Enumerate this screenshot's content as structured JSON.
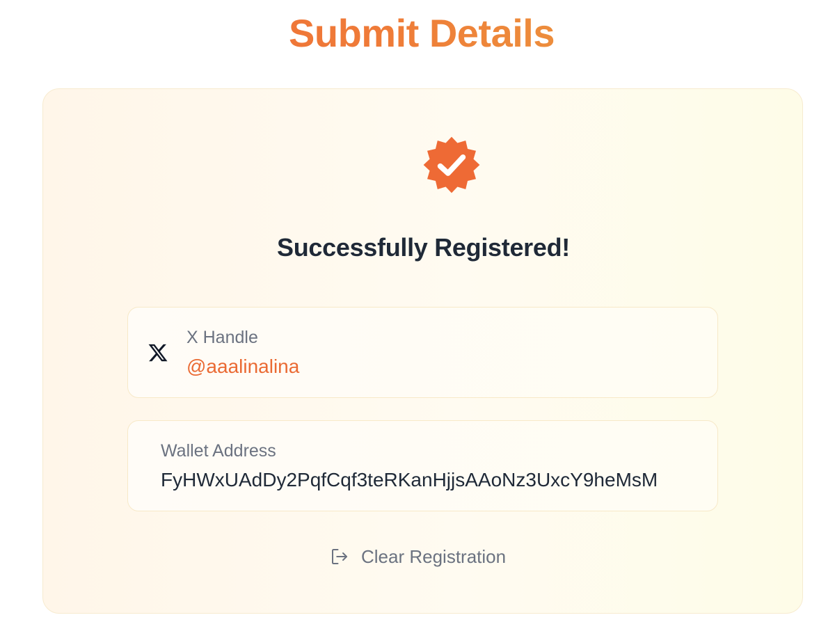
{
  "page": {
    "title": "Submit Details"
  },
  "status": {
    "badge_icon": "verified-badge-icon",
    "headline": "Successfully Registered!",
    "accent_color": "#EE6A35"
  },
  "x_handle": {
    "icon": "x-logo-icon",
    "label": "X Handle",
    "value": "@aaalinalina"
  },
  "wallet": {
    "label": "Wallet Address",
    "value": "FyHWxUAdDy2PqfCqf3teRKanHjjsAAoNz3UxcY9heMsM"
  },
  "actions": {
    "clear_icon": "logout-icon",
    "clear_label": "Clear Registration"
  }
}
